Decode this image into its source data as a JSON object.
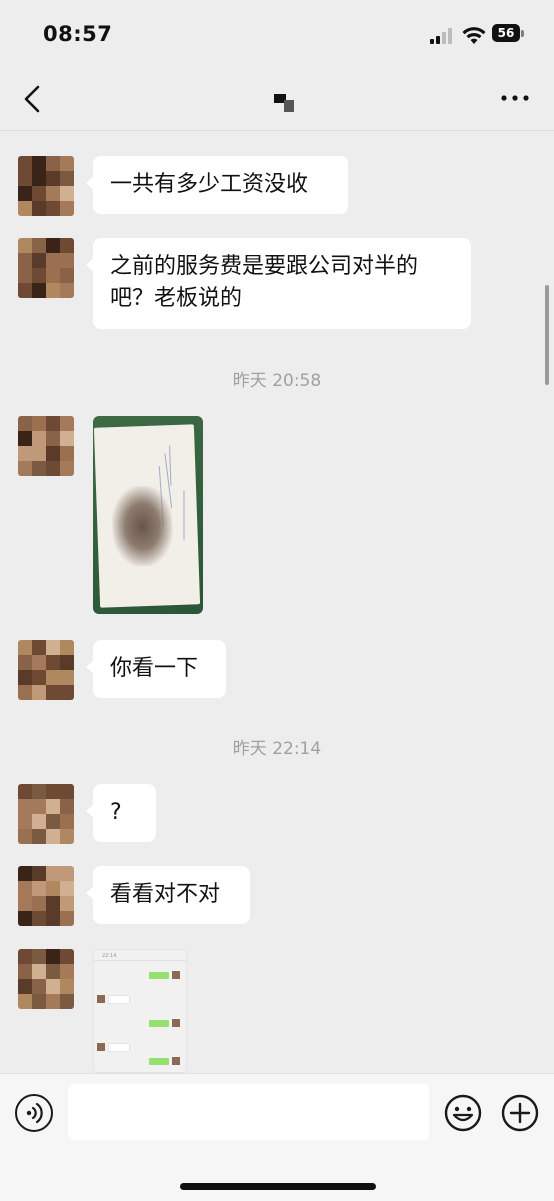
{
  "status_bar": {
    "time": "08:57",
    "battery": "56"
  },
  "nav": {
    "back_icon": "chevron-left-icon",
    "more_icon": "more-dots-icon"
  },
  "messages": [
    {
      "type": "text",
      "text": "一共有多少工资没收"
    },
    {
      "type": "text",
      "text": "之前的服务费是要跟公司对半的吧？老板说的"
    },
    {
      "type": "timestamp",
      "text": "昨天 20:58"
    },
    {
      "type": "image",
      "label": "photo-of-paper"
    },
    {
      "type": "text",
      "text": "你看一下"
    },
    {
      "type": "timestamp",
      "text": "昨天 22:14"
    },
    {
      "type": "text",
      "text": "?"
    },
    {
      "type": "text",
      "text": "看看对不对"
    },
    {
      "type": "image",
      "label": "chat-screenshot"
    }
  ],
  "input_bar": {
    "placeholder": "",
    "voice_icon": "voice-icon",
    "emoji_icon": "emoji-icon",
    "plus_icon": "plus-icon"
  },
  "colors": {
    "background": "#ededed",
    "bubble": "#ffffff",
    "timestamp": "#a0a0a0",
    "wechat_green": "#95ec69"
  }
}
